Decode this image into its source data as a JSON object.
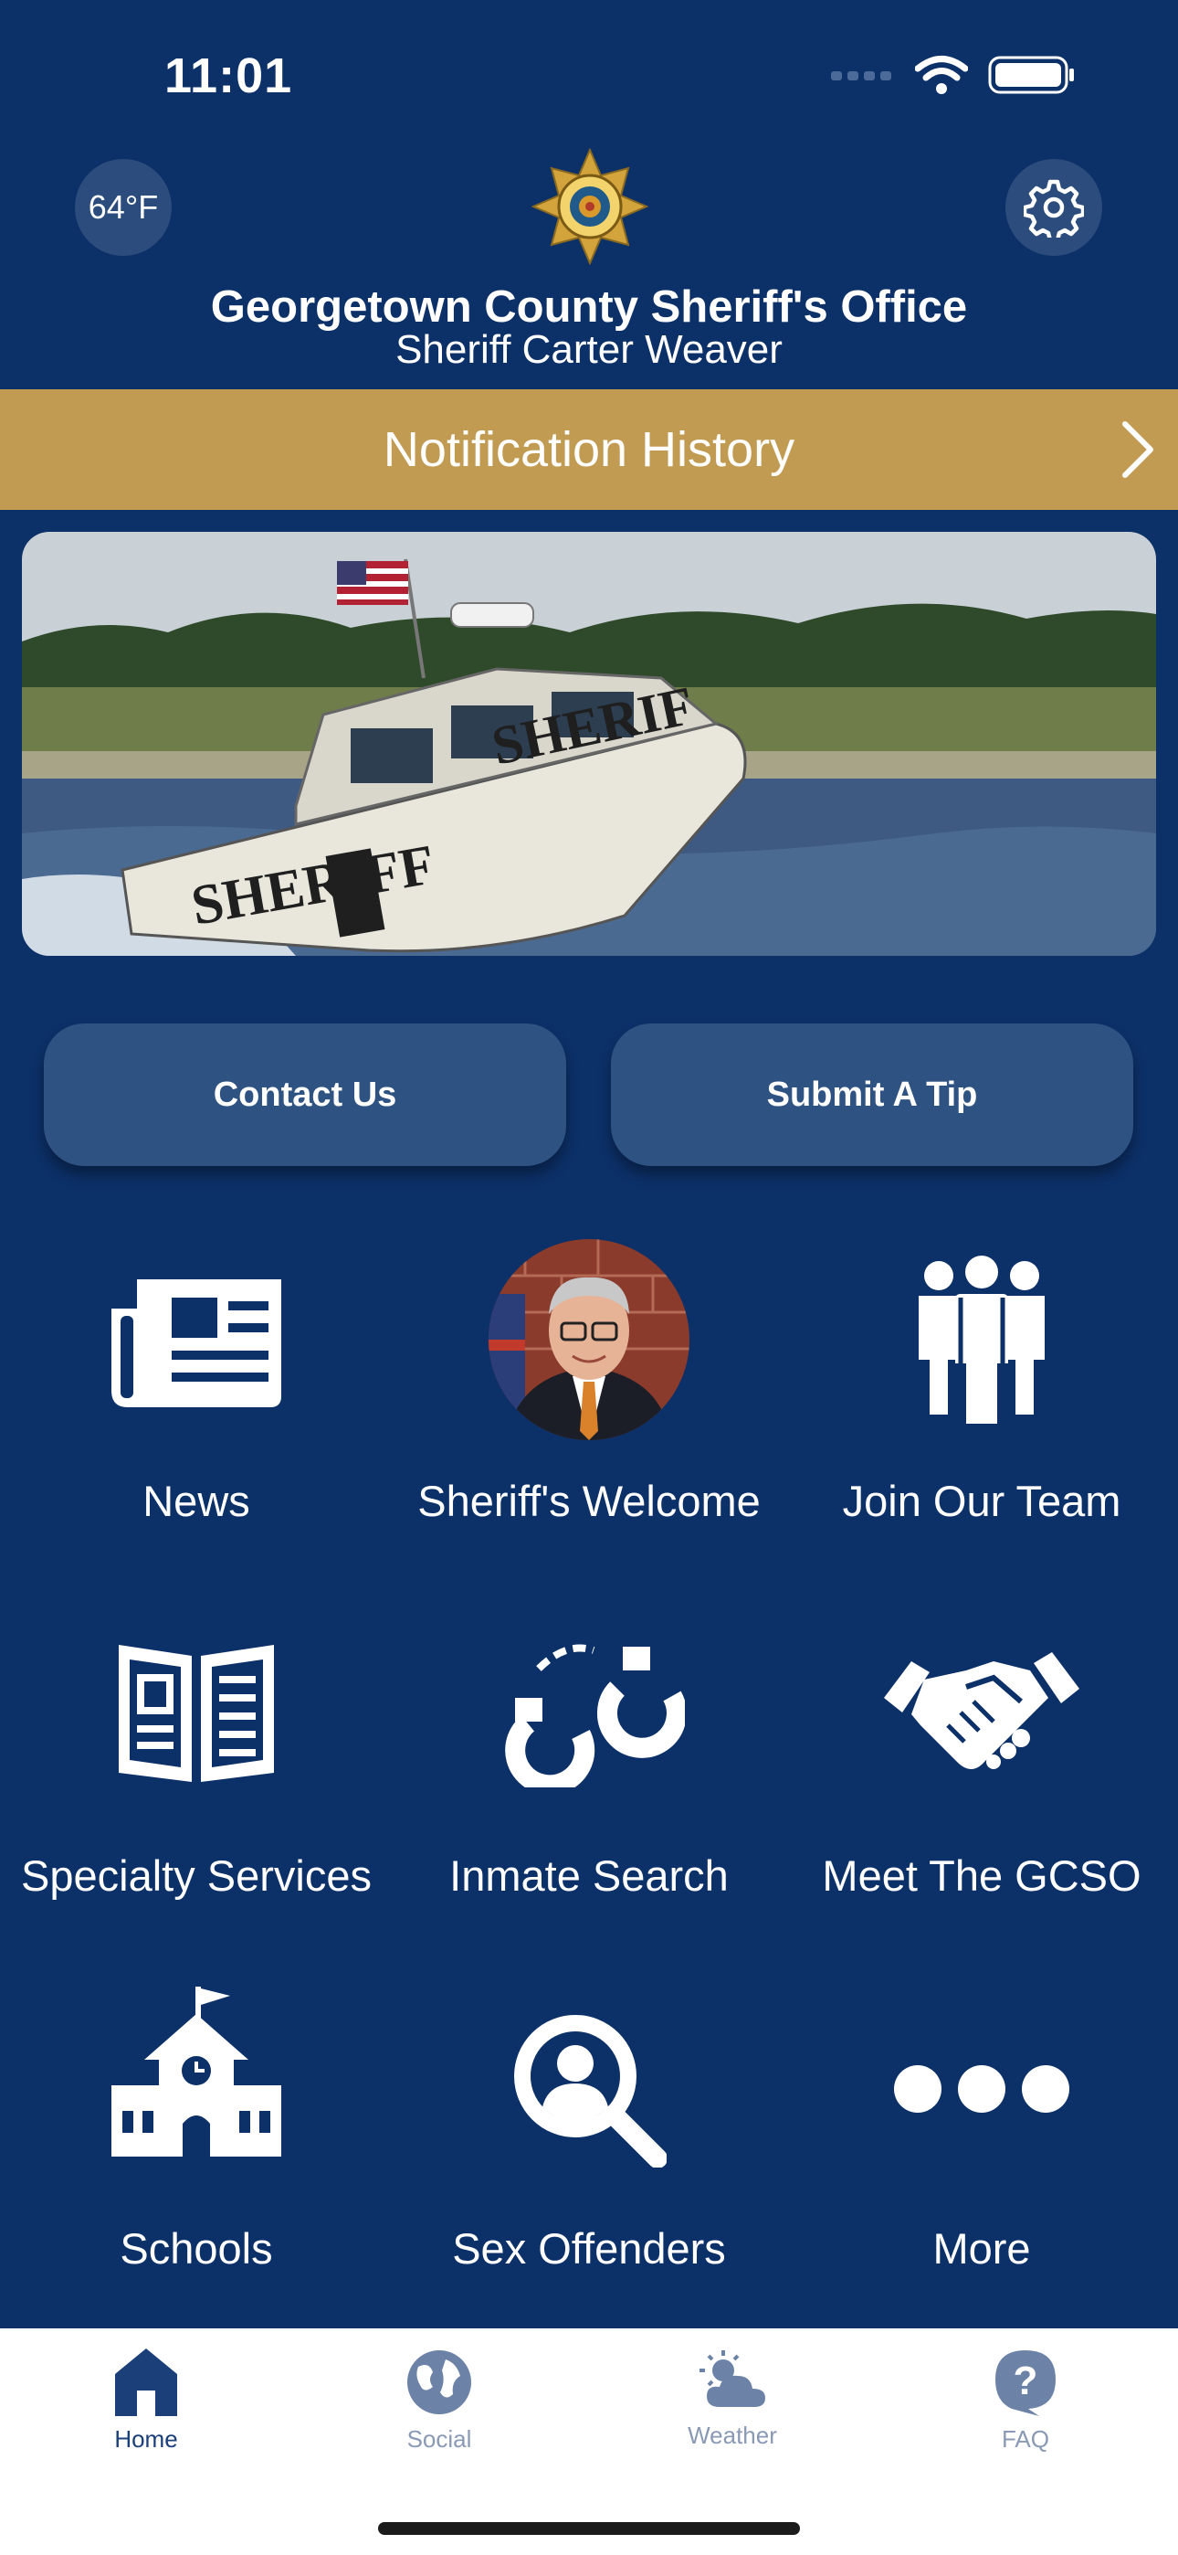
{
  "status_bar": {
    "time": "11:01"
  },
  "header": {
    "temperature": "64°F",
    "title": "Georgetown County Sheriff's Office",
    "subtitle": "Sheriff Carter Weaver"
  },
  "notification": {
    "label": "Notification History"
  },
  "actions": {
    "contact_label": "Contact Us",
    "tip_label": "Submit A Tip"
  },
  "tiles": [
    {
      "label": "News",
      "icon": "newspaper-icon"
    },
    {
      "label": "Sheriff's Welcome",
      "icon": "sheriff-portrait"
    },
    {
      "label": "Join Our Team",
      "icon": "team-icon"
    },
    {
      "label": "Specialty Services",
      "icon": "open-book-icon"
    },
    {
      "label": "Inmate Search",
      "icon": "handcuffs-icon"
    },
    {
      "label": "Meet The GCSO",
      "icon": "handshake-icon"
    },
    {
      "label": "Schools",
      "icon": "school-icon"
    },
    {
      "label": "Sex Offenders",
      "icon": "person-search-icon"
    },
    {
      "label": "More",
      "icon": "more-dots-icon"
    }
  ],
  "tab_bar": {
    "tabs": [
      {
        "label": "Home",
        "icon": "home-icon",
        "active": true
      },
      {
        "label": "Social",
        "icon": "globe-icon",
        "active": false
      },
      {
        "label": "Weather",
        "icon": "weather-icon",
        "active": false
      },
      {
        "label": "FAQ",
        "icon": "question-icon",
        "active": false
      }
    ]
  },
  "colors": {
    "background": "#0c3068",
    "accent_gold": "#c29b53",
    "button": "#2e5282",
    "tab_active": "#1b3f79",
    "tab_inactive": "#8a9ab5"
  }
}
